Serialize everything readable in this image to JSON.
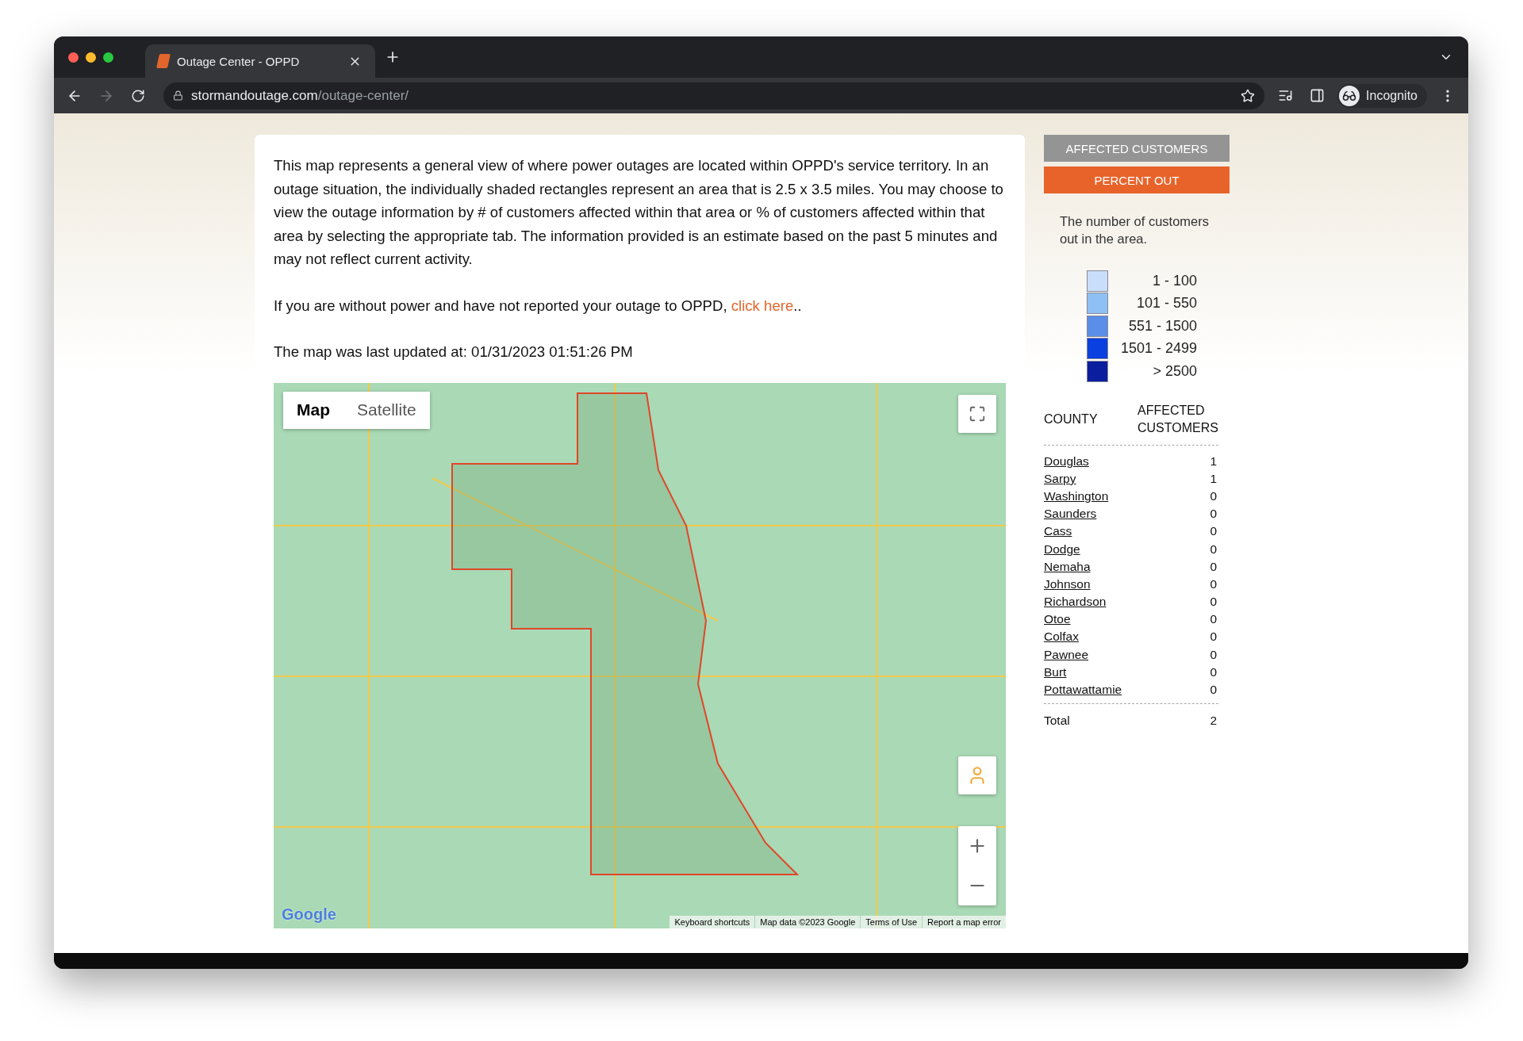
{
  "browser": {
    "tab_title": "Outage Center - OPPD",
    "url_host": "stormandoutage.com",
    "url_path": "/outage-center/",
    "profile": "Incognito",
    "forward_disabled": true
  },
  "intro": {
    "paragraphs": [
      "This map represents a general view of where power outages are located within OPPD's service territory. In an outage situation, the individually shaded rectangles represent an area that is 2.5 x 3.5 miles. You may choose to view the outage information by # of customers affected within that area or % of customers affected within that area by selecting the appropriate tab. The information provided is an estimate based on the past 5 minutes and may not reflect current activity."
    ],
    "report_text": "If you are without power and have not reported your outage to OPPD, ",
    "report_link": "click here",
    "report_suffix": "..",
    "updated": "The map was last updated at: 01/31/2023 01:51:26 PM"
  },
  "map": {
    "type_tabs": [
      {
        "label": "Map",
        "selected": true
      },
      {
        "label": "Satellite",
        "selected": false
      }
    ],
    "logo": "Google",
    "footer": [
      "Keyboard shortcuts",
      "Map data ©2023 Google",
      "Terms of Use",
      "Report a map error"
    ]
  },
  "sidebar": {
    "view_tabs": [
      {
        "label": "AFFECTED CUSTOMERS",
        "selected": true
      },
      {
        "label": "PERCENT OUT",
        "selected": false
      }
    ],
    "description": "The number of customers out in the area.",
    "legend": [
      {
        "label": "1 - 100",
        "color": "#c9defa"
      },
      {
        "label": "101 - 550",
        "color": "#8ec0f5"
      },
      {
        "label": "551 - 1500",
        "color": "#5a8ee8"
      },
      {
        "label": "1501 - 2499",
        "color": "#0a3fe0"
      },
      {
        "label": "> 2500",
        "color": "#0a1e9e"
      }
    ],
    "table": {
      "columns": [
        "COUNTY",
        "AFFECTED CUSTOMERS"
      ],
      "rows": [
        {
          "county": "Douglas",
          "count": "1"
        },
        {
          "county": "Sarpy",
          "count": "1"
        },
        {
          "county": "Washington",
          "count": "0"
        },
        {
          "county": "Saunders",
          "count": "0"
        },
        {
          "county": "Cass",
          "count": "0"
        },
        {
          "county": "Dodge",
          "count": "0"
        },
        {
          "county": "Nemaha",
          "count": "0"
        },
        {
          "county": "Johnson",
          "count": "0"
        },
        {
          "county": "Richardson",
          "count": "0"
        },
        {
          "county": "Otoe",
          "count": "0"
        },
        {
          "county": "Colfax",
          "count": "0"
        },
        {
          "county": "Pawnee",
          "count": "0"
        },
        {
          "county": "Burt",
          "count": "0"
        },
        {
          "county": "Pottawattamie",
          "count": "0"
        }
      ],
      "total_label": "Total",
      "total": "2"
    }
  }
}
